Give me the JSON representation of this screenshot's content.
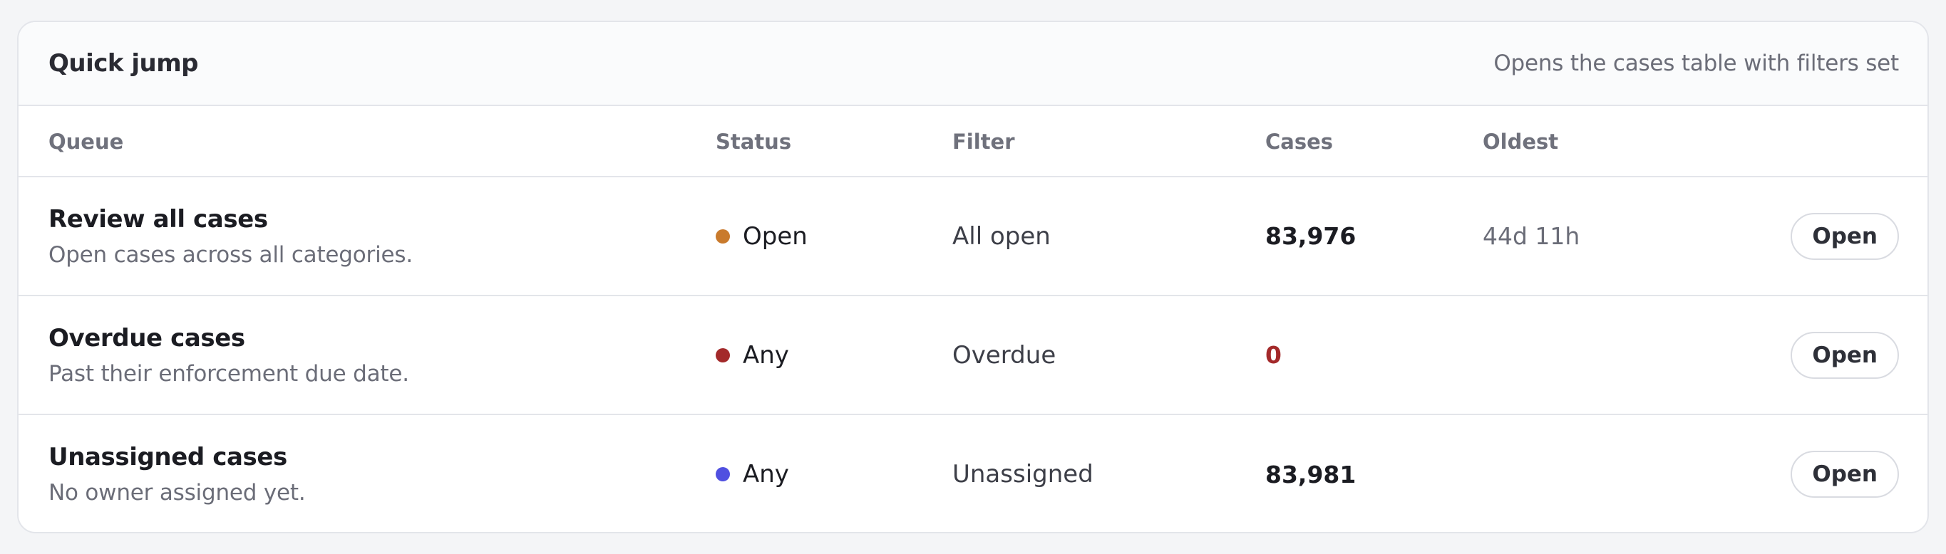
{
  "header": {
    "title": "Quick jump",
    "subtitle": "Opens the cases table with filters set"
  },
  "columns": {
    "queue": "Queue",
    "status": "Status",
    "filter": "Filter",
    "cases": "Cases",
    "oldest": "Oldest"
  },
  "rows": [
    {
      "title": "Review all cases",
      "description": "Open cases across all categories.",
      "status": "Open",
      "status_color": "#c97a2c",
      "filter": "All open",
      "cases": "83,976",
      "oldest": "44d 11h",
      "action": "Open"
    },
    {
      "title": "Overdue cases",
      "description": "Past their enforcement due date.",
      "status": "Any",
      "status_color": "#a3292a",
      "filter": "Overdue",
      "cases": "0",
      "oldest": "",
      "action": "Open"
    },
    {
      "title": "Unassigned cases",
      "description": "No owner assigned yet.",
      "status": "Any",
      "status_color": "#5050e0",
      "filter": "Unassigned",
      "cases": "83,981",
      "oldest": "",
      "action": "Open"
    }
  ],
  "colors": {
    "zero_cases": "#a3292a"
  }
}
